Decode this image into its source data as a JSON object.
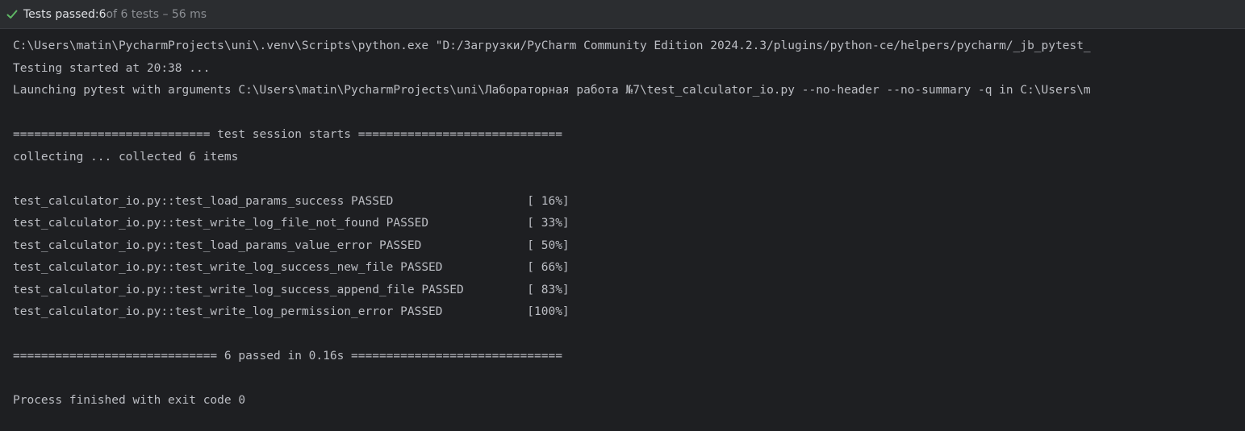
{
  "status": {
    "icon": "check-icon",
    "passed_label": "Tests passed: ",
    "passed_count": "6",
    "total_text": " of 6 tests – 56 ms",
    "accent_color": "#5fb865"
  },
  "console": {
    "lines": [
      "C:\\Users\\matin\\PycharmProjects\\uni\\.venv\\Scripts\\python.exe \"D:/Загрузки/PyCharm Community Edition 2024.2.3/plugins/python-ce/helpers/pycharm/_jb_pytest_",
      "Testing started at 20:38 ...",
      "Launching pytest with arguments C:\\Users\\matin\\PycharmProjects\\uni\\Лабораторная работа №7\\test_calculator_io.py --no-header --no-summary -q in C:\\Users\\m",
      "",
      "============================ test session starts =============================",
      "collecting ... collected 6 items",
      "",
      "test_calculator_io.py::test_load_params_success PASSED                   [ 16%]",
      "test_calculator_io.py::test_write_log_file_not_found PASSED              [ 33%]",
      "test_calculator_io.py::test_load_params_value_error PASSED               [ 50%]",
      "test_calculator_io.py::test_write_log_success_new_file PASSED            [ 66%]",
      "test_calculator_io.py::test_write_log_success_append_file PASSED         [ 83%]",
      "test_calculator_io.py::test_write_log_permission_error PASSED            [100%]",
      "",
      "============================= 6 passed in 0.16s ==============================",
      "",
      "Process finished with exit code 0"
    ]
  }
}
